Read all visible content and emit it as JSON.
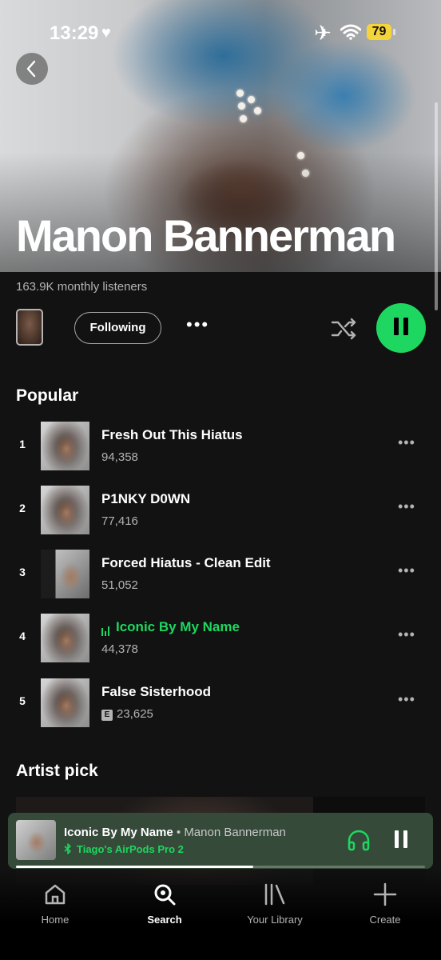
{
  "status_bar": {
    "time": "13:29",
    "battery": "79",
    "icons": [
      "heart-icon",
      "airplane-icon",
      "wifi-icon",
      "battery-icon"
    ]
  },
  "header": {
    "back_icon": "chevron-left-icon",
    "artist_name": "Manon Bannerman"
  },
  "artist": {
    "monthly_listeners": "163.9K monthly listeners",
    "follow_label": "Following",
    "more_icon": "more-horizontal-icon",
    "shuffle_icon": "shuffle-icon",
    "play_state_icon": "pause-icon"
  },
  "popular": {
    "title": "Popular",
    "tracks": [
      {
        "rank": "1",
        "title": "Fresh Out This Hiatus",
        "plays": "94,358",
        "explicit": false,
        "playing": false
      },
      {
        "rank": "2",
        "title": "P1NKY D0WN",
        "plays": "77,416",
        "explicit": false,
        "playing": false
      },
      {
        "rank": "3",
        "title": "Forced Hiatus - Clean Edit",
        "plays": "51,052",
        "explicit": false,
        "playing": false
      },
      {
        "rank": "4",
        "title": "Iconic By My Name",
        "plays": "44,378",
        "explicit": false,
        "playing": true
      },
      {
        "rank": "5",
        "title": "False Sisterhood",
        "plays": "23,625",
        "explicit": true,
        "explicit_label": "E",
        "playing": false
      }
    ]
  },
  "artist_pick": {
    "title": "Artist pick"
  },
  "now_playing": {
    "title": "Iconic By My Name",
    "separator": " • ",
    "artist": "Manon Bannerman",
    "device": "Tiago's AirPods Pro 2",
    "device_icon": "bluetooth-icon",
    "output_icon": "headphones-icon",
    "progress": 0.58
  },
  "tabs": [
    {
      "label": "Home",
      "icon": "home-icon",
      "active": false
    },
    {
      "label": "Search",
      "icon": "search-icon",
      "active": true
    },
    {
      "label": "Your Library",
      "icon": "library-icon",
      "active": false
    },
    {
      "label": "Create",
      "icon": "plus-icon",
      "active": false
    }
  ],
  "colors": {
    "accent": "#1ed760",
    "background": "#121212",
    "now_playing_bg": "#354a39",
    "battery": "#f5d33a"
  }
}
